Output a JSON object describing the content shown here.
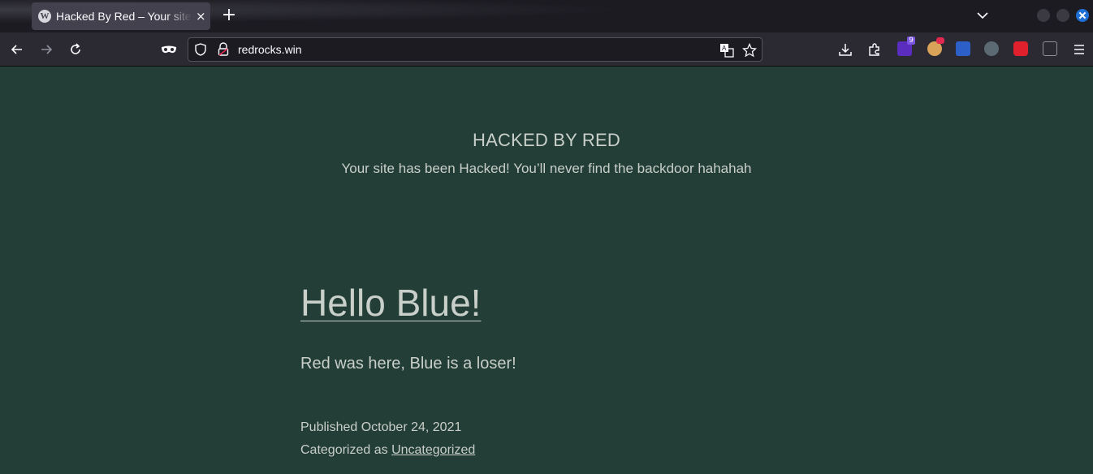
{
  "browser": {
    "tab": {
      "title": "Hacked By Red – Your site has been Hacked!",
      "favicon_letter": "W",
      "close_glyph": "×"
    },
    "new_tab_glyph": "+",
    "url": "redrocks.win",
    "extension_badge": "9",
    "icons": {
      "back": "arrow-left-icon",
      "forward": "arrow-right-icon",
      "reload": "reload-icon",
      "private": "mask-icon",
      "shield": "shield-icon",
      "lock": "lock-icon",
      "translate": "translate-icon",
      "bookmark": "star-icon",
      "downloads": "download-icon",
      "extensions": "puzzle-icon",
      "menu": "hamburger-menu-icon"
    },
    "colors": {
      "close_button": "#1f6fd6",
      "page_bg": "#233d37",
      "text": "#c9cfc9"
    }
  },
  "site": {
    "title": "HACKED BY RED",
    "description": "Your site has been Hacked! You’ll never find the backdoor hahahah"
  },
  "post": {
    "title": "Hello Blue!",
    "body": "Red was here, Blue is a loser!",
    "published_label": "Published",
    "published_date": "October 24, 2021",
    "category_label": "Categorized as",
    "category": "Uncategorized"
  }
}
